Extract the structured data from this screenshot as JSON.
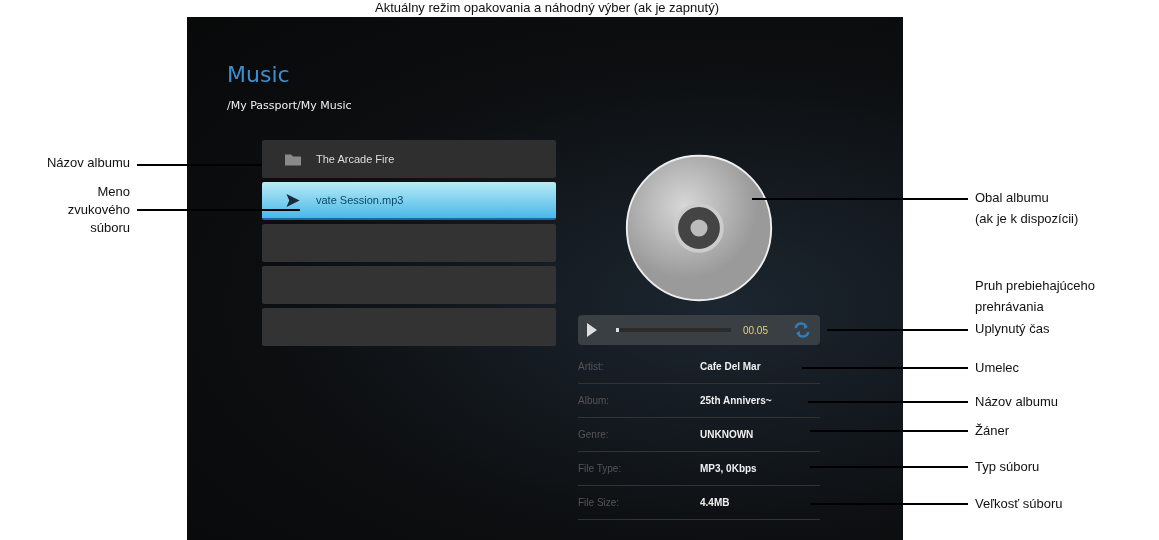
{
  "top_caption": "Aktuálny režim opakovania a náhodný výber (ak je zapnutý)",
  "screen": {
    "title": "Music",
    "path": "/My Passport/My Music",
    "list": [
      {
        "kind": "folder",
        "label": "The Arcade Fire",
        "selected": false
      },
      {
        "kind": "file",
        "label": "vate Session.mp3",
        "selected": true
      },
      {
        "kind": "empty",
        "selected": false
      },
      {
        "kind": "empty",
        "selected": false
      },
      {
        "kind": "empty",
        "selected": false
      }
    ],
    "player": {
      "elapsed": "00.05",
      "level": 0.03
    },
    "info": [
      {
        "label": "Artist:",
        "value": "Cafe Del Mar"
      },
      {
        "label": "Album:",
        "value": "25th Annivers~"
      },
      {
        "label": "Genre:",
        "value": "UNKNOWN"
      },
      {
        "label": "File Type:",
        "value": "MP3, 0Kbps"
      },
      {
        "label": "File Size:",
        "value": "4.4MB"
      }
    ]
  },
  "callouts_left": [
    {
      "lines": [
        "Názov albumu"
      ]
    },
    {
      "lines": [
        "Meno",
        "zvukového",
        "súboru"
      ]
    }
  ],
  "callouts_right": [
    {
      "lines": [
        "Obal albumu",
        "(ak je k dispozícii)"
      ]
    },
    {
      "lines": [
        "Pruh prebiehajúceho",
        "prehrávania"
      ]
    },
    {
      "lines": [
        "Uplynutý čas"
      ]
    },
    {
      "lines": [
        "Umelec"
      ]
    },
    {
      "lines": [
        "Názov albumu"
      ]
    },
    {
      "lines": [
        "Žáner"
      ]
    },
    {
      "lines": [
        "Typ súboru"
      ]
    },
    {
      "lines": [
        "Veľkosť súboru"
      ]
    }
  ]
}
